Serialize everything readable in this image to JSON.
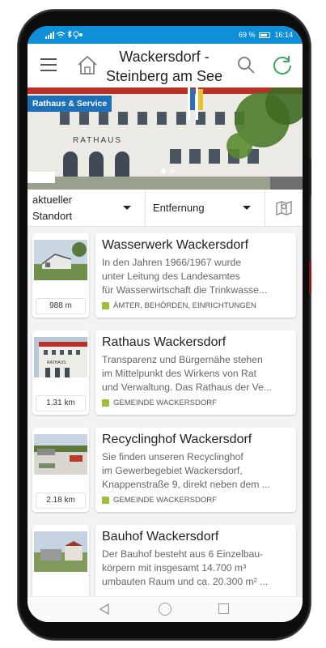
{
  "status_bar": {
    "battery": "69 %",
    "time": "16:14",
    "left_icons": [
      "signal-icon",
      "wifi-icon",
      "bluetooth-icon",
      "location-icon",
      "app-icon"
    ]
  },
  "header": {
    "title": "Wackersdorf - Steinberg am See",
    "menu_icon": "menu-icon",
    "home_icon": "home-icon",
    "search_icon": "search-icon",
    "refresh_icon": "refresh-icon"
  },
  "hero": {
    "badge": "Rathaus & Service",
    "building_sign": "RATHAUS",
    "active_slide": 1,
    "slide_count": 2
  },
  "filters": {
    "location_line1": "aktueller",
    "location_line2": "Standort",
    "sort": "Entfernung",
    "map_icon": "map-icon"
  },
  "list": [
    {
      "title": "Wasserwerk Wackersdorf",
      "desc": [
        "In den Jahren 1966/1967 wurde",
        "unter Leitung des Landesamtes",
        "für Wasserwirtschaft die Trinkwasse..."
      ],
      "category": "ÄMTER, BEHÖRDEN, EINRICHTUNGEN",
      "distance": "988 m"
    },
    {
      "title": "Rathaus Wackersdorf",
      "desc": [
        "Transparenz und Bürgernähe stehen",
        "im Mittelpunkt des Wirkens von Rat",
        "und Verwaltung. Das Rathaus der Ve..."
      ],
      "category": "GEMEINDE WACKERSDORF",
      "distance": "1.31 km"
    },
    {
      "title": "Recyclinghof Wackersdorf",
      "desc": [
        "Sie finden unseren Recyclinghof",
        "im Gewerbegebiet Wackersdorf,",
        "Knappenstraße 9, direkt neben dem ..."
      ],
      "category": "GEMEINDE WACKERSDORF",
      "distance": "2.18 km"
    },
    {
      "title": "Bauhof Wackersdorf",
      "desc": [
        "Der Bauhof besteht aus 6 Einzelbau-",
        "körpern mit insgesamt 14.700 m³",
        "umbauten Raum und ca. 20.300 m² ..."
      ],
      "category": "",
      "distance": ""
    }
  ],
  "colors": {
    "status_bar": "#0f8fd8",
    "accent_green": "#3aa75a",
    "category_green": "#9bc03c",
    "badge_blue": "#1d6fb8"
  }
}
